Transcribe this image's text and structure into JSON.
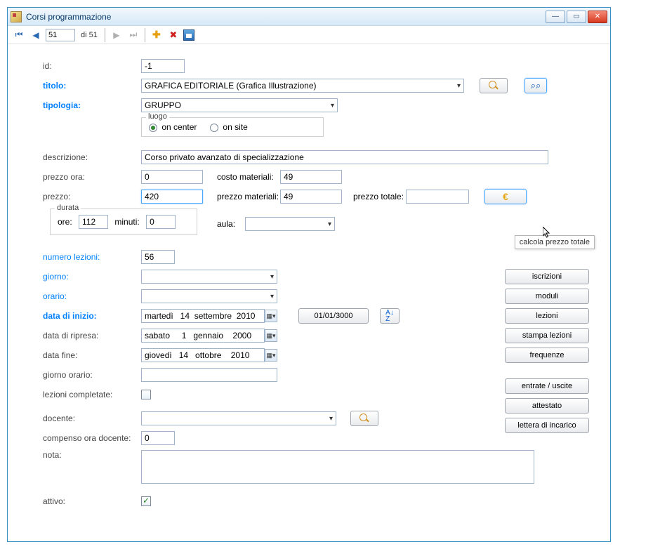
{
  "window": {
    "title": "Corsi programmazione"
  },
  "nav": {
    "current": "51",
    "total_prefix": "di ",
    "total": "51"
  },
  "labels": {
    "id": "id:",
    "titolo": "titolo:",
    "tipologia": "tipologia:",
    "luogo": "luogo",
    "on_center": "on center",
    "on_site": "on site",
    "descrizione": "descrizione:",
    "prezzo_ora": "prezzo ora:",
    "costo_materiali": "costo materiali:",
    "prezzo": "prezzo:",
    "prezzo_materiali": "prezzo materiali:",
    "prezzo_totale": "prezzo totale:",
    "durata": "durata",
    "ore": "ore:",
    "minuti": "minuti:",
    "aula": "aula:",
    "numero_lezioni": "numero lezioni:",
    "giorno": "giorno:",
    "orario": "orario:",
    "data_di_inizio": "data di inizio:",
    "data_di_ripresa": "data di ripresa:",
    "data_fine": "data fine:",
    "giorno_orario": "giorno orario:",
    "lezioni_completate": "lezioni completate:",
    "docente": "docente:",
    "compenso_ora_docente": "compenso ora docente:",
    "nota": "nota:",
    "attivo": "attivo:"
  },
  "values": {
    "id": "-1",
    "titolo": "GRAFICA EDITORIALE (Grafica Illustrazione)",
    "tipologia": "GRUPPO",
    "descrizione": "Corso privato avanzato di specializzazione",
    "prezzo_ora": "0",
    "costo_materiali": "49",
    "prezzo": "420",
    "prezzo_materiali": "49",
    "prezzo_totale": "",
    "ore": "112",
    "minuti": "0",
    "aula": "",
    "numero_lezioni": "56",
    "giorno": "",
    "orario": "",
    "data_di_inizio": "martedì   14  settembre  2010",
    "data_di_ripresa": "sabato     1   gennaio    2000",
    "data_fine": "giovedì   14   ottobre    2010",
    "giorno_orario": "",
    "docente": "",
    "compenso_ora_docente": "0",
    "nota": ""
  },
  "buttons": {
    "date_reset": "01/01/3000",
    "euro": "€",
    "iscrizioni": "iscrizioni",
    "moduli": "moduli",
    "lezioni": "lezioni",
    "stampa_lezioni": "stampa lezioni",
    "frequenze": "frequenze",
    "entrate_uscite": "entrate / uscite",
    "attestato": "attestato",
    "lettera_di_incarico": "lettera di incarico"
  },
  "tooltip": "calcola prezzo totale"
}
